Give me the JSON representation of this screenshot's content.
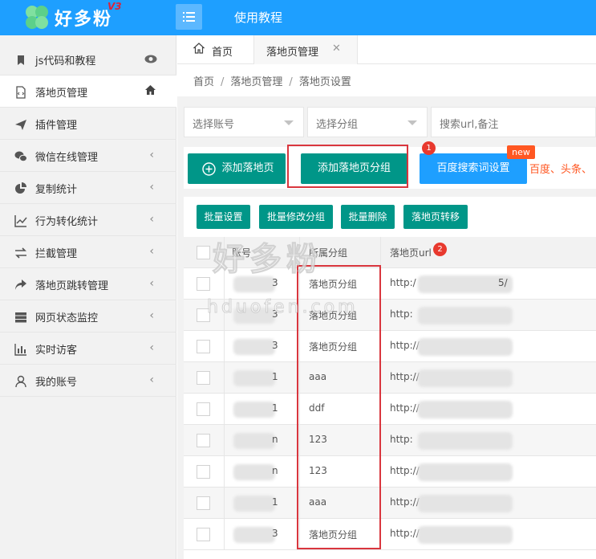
{
  "app": {
    "logo_text": "好多粉",
    "logo_version": "V3",
    "top_nav": "使用教程"
  },
  "sidebar": {
    "items": [
      {
        "label": "js代码和教程",
        "icon": "bookmark-icon",
        "trail": "eye-icon"
      },
      {
        "label": "落地页管理",
        "icon": "file-code-icon",
        "trail": "home-icon"
      },
      {
        "label": "插件管理",
        "icon": "send-icon"
      },
      {
        "label": "微信在线管理",
        "icon": "wechat-icon",
        "trail": "chevron-left-icon"
      },
      {
        "label": "复制统计",
        "icon": "pie-chart-icon",
        "trail": "chevron-left-icon"
      },
      {
        "label": "行为转化统计",
        "icon": "line-chart-icon",
        "trail": "chevron-left-icon"
      },
      {
        "label": "拦截管理",
        "icon": "exchange-icon",
        "trail": "chevron-left-icon"
      },
      {
        "label": "落地页跳转管理",
        "icon": "share-icon",
        "trail": "chevron-left-icon"
      },
      {
        "label": "网页状态监控",
        "icon": "server-icon",
        "trail": "chevron-left-icon"
      },
      {
        "label": "实时访客",
        "icon": "bar-chart-icon",
        "trail": "chevron-left-icon"
      },
      {
        "label": "我的账号",
        "icon": "user-icon",
        "trail": "chevron-left-icon"
      }
    ]
  },
  "tabs": {
    "home": "首页",
    "active": "落地页管理",
    "close": "✕"
  },
  "breadcrumb": {
    "a": "首页",
    "b": "落地页管理",
    "c": "落地页设置",
    "sep": "/"
  },
  "filters": {
    "account": "选择账号",
    "group": "选择分组",
    "search_placeholder": "搜索url,备注"
  },
  "actions": {
    "add_page": "添加落地页",
    "add_group": "添加落地页分组",
    "baidu": "百度搜索词设置",
    "new_badge": "new",
    "extra": "百度、头条、",
    "badge1": "1",
    "badge2": "2"
  },
  "batch": {
    "set": "批量设置",
    "edit_group": "批量修改分组",
    "delete": "批量删除",
    "transfer": "落地页转移"
  },
  "table": {
    "headers": {
      "account": "账号",
      "group": "所属分组",
      "url": "落地页url"
    },
    "rows": [
      {
        "account": "3",
        "group": "落地页分组",
        "url": "http:/",
        "tail": "5/"
      },
      {
        "account": "3",
        "group": "落地页分组",
        "url": "http:",
        "tail": ""
      },
      {
        "account": "3",
        "group": "落地页分组",
        "url": "http://1",
        "tail": ""
      },
      {
        "account": "1",
        "group": "aaa",
        "url": "http://",
        "tail": ""
      },
      {
        "account": "1",
        "group": "ddf",
        "url": "http://",
        "tail": ""
      },
      {
        "account": "n",
        "group": "123",
        "url": "http:",
        "tail": ""
      },
      {
        "account": "n",
        "group": "123",
        "url": "http://",
        "tail": ""
      },
      {
        "account": "1",
        "group": "aaa",
        "url": "http://",
        "tail": ""
      },
      {
        "account": "3",
        "group": "落地页分组",
        "url": "http://1",
        "tail": ""
      }
    ]
  },
  "watermark": {
    "main": "好多粉",
    "sub": "hduofen.com"
  },
  "colors": {
    "primary": "#1e9fff",
    "green": "#009688",
    "red": "#d9363e",
    "orange": "#ff5722"
  }
}
